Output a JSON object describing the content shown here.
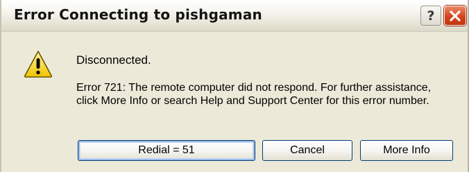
{
  "window": {
    "title": "Error Connecting to pishgaman",
    "help_glyph": "?",
    "colors": {
      "face": "#ece9d8",
      "close_red": "#d6441d",
      "button_border": "#003c74"
    }
  },
  "message": {
    "icon": "warning-icon",
    "title": "Disconnected.",
    "body": "Error 721: The remote computer did not respond. For further assistance, click More Info or search Help and Support Center for this error number."
  },
  "buttons": {
    "redial": "Redial = 51",
    "cancel": "Cancel",
    "more_info": "More Info"
  }
}
